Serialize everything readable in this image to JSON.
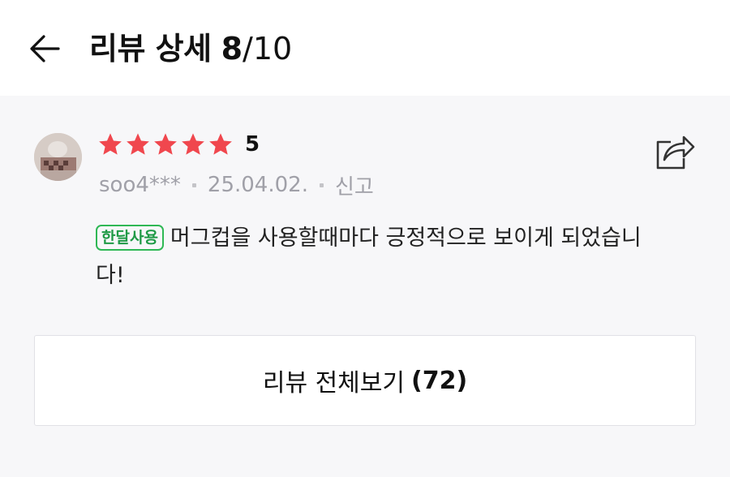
{
  "header": {
    "title": "리뷰 상세",
    "current_index": "8",
    "separator": "/",
    "total": "10",
    "back_icon": "arrow-left-icon"
  },
  "review": {
    "avatar_icon": "user-avatar",
    "stars": 5,
    "star_color": "#f0474e",
    "rating_text": "5",
    "username": "soo4***",
    "date": "25.04.02.",
    "report_label": "신고",
    "badge": "한달사용",
    "badge_color": "#2fb855",
    "text": "머그컵을 사용할때마다 긍정적으로 보이게 되었습니다!",
    "share_icon": "share-icon"
  },
  "footer": {
    "all_reviews_label": "리뷰 전체보기",
    "count": "(72)"
  }
}
